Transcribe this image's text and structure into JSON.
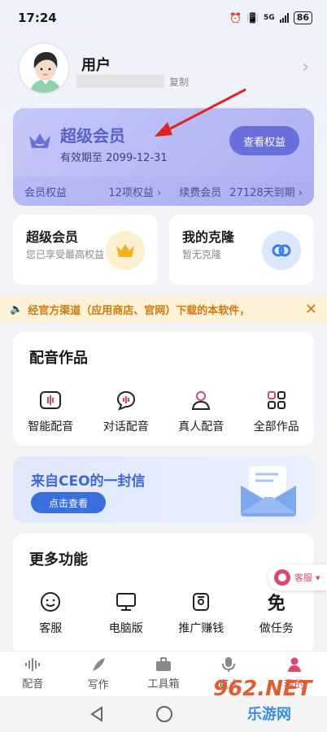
{
  "status": {
    "time": "17:24",
    "network": "5G",
    "battery": "86"
  },
  "profile": {
    "name": "用户",
    "copy": "复制"
  },
  "vip": {
    "title": "超级会员",
    "expire": "有效期至 2099-12-31",
    "button": "查看权益",
    "benefits_label": "会员权益",
    "benefits_count": "12项权益",
    "renew_label": "续费会员",
    "renew_days": "27128天到期"
  },
  "cards": {
    "super_title": "超级会员",
    "super_sub": "您已享受最高权益",
    "clone_title": "我的克隆",
    "clone_sub": "暂无克隆"
  },
  "notice": {
    "text": "经官方渠道（应用商店、官网）下载的本软件，"
  },
  "dubbing": {
    "title": "配音作品",
    "items": [
      "智能配音",
      "对话配音",
      "真人配音",
      "全部作品"
    ]
  },
  "letter": {
    "title": "来自CEO的一封信",
    "button": "点击查看"
  },
  "more": {
    "title": "更多功能",
    "items": [
      "客服",
      "电脑版",
      "推广赚钱",
      "做任务"
    ]
  },
  "float": {
    "label": "客服"
  },
  "tabs": [
    "配音",
    "写作",
    "工具箱",
    "真人",
    "我的"
  ],
  "watermark": {
    "number": "962.NET",
    "site": "乐游网"
  },
  "colors": {
    "accent": "#e0466b",
    "vip": "#5a5fc8",
    "letter": "#3e66d8",
    "notice": "#d07a0e"
  }
}
